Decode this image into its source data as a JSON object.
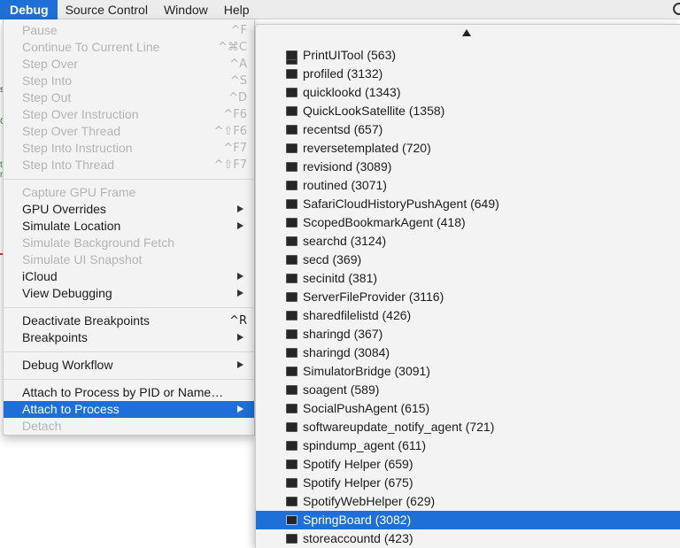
{
  "menubar": {
    "items": [
      "Debug",
      "Source Control",
      "Window",
      "Help"
    ]
  },
  "debug_menu": {
    "items": [
      {
        "label": "Pause",
        "shortcut": "^F",
        "enabled": false
      },
      {
        "label": "Continue To Current Line",
        "shortcut": "^⌘C",
        "enabled": false
      },
      {
        "label": "Step Over",
        "shortcut": "^A",
        "enabled": false
      },
      {
        "label": "Step Into",
        "shortcut": "^S",
        "enabled": false
      },
      {
        "label": "Step Out",
        "shortcut": "^D",
        "enabled": false
      },
      {
        "label": "Step Over Instruction",
        "shortcut": "^F6",
        "enabled": false
      },
      {
        "label": "Step Over Thread",
        "shortcut": "^⇧F6",
        "enabled": false
      },
      {
        "label": "Step Into Instruction",
        "shortcut": "^F7",
        "enabled": false
      },
      {
        "label": "Step Into Thread",
        "shortcut": "^⇧F7",
        "enabled": false
      },
      {
        "label": "Capture GPU Frame",
        "shortcut": "",
        "enabled": false
      },
      {
        "label": "GPU Overrides",
        "shortcut": "",
        "enabled": true,
        "submenu": true
      },
      {
        "label": "Simulate Location",
        "shortcut": "",
        "enabled": true,
        "submenu": true
      },
      {
        "label": "Simulate Background Fetch",
        "shortcut": "",
        "enabled": false
      },
      {
        "label": "Simulate UI Snapshot",
        "shortcut": "",
        "enabled": false
      },
      {
        "label": "iCloud",
        "shortcut": "",
        "enabled": true,
        "submenu": true
      },
      {
        "label": "View Debugging",
        "shortcut": "",
        "enabled": true,
        "submenu": true
      },
      {
        "label": "Deactivate Breakpoints",
        "shortcut": "^R",
        "enabled": true
      },
      {
        "label": "Breakpoints",
        "shortcut": "",
        "enabled": true,
        "submenu": true
      },
      {
        "label": "Debug Workflow",
        "shortcut": "",
        "enabled": true,
        "submenu": true
      },
      {
        "label": "Attach to Process by PID or Name…",
        "shortcut": "",
        "enabled": true
      },
      {
        "label": "Attach to Process",
        "shortcut": "",
        "enabled": true,
        "submenu": true,
        "highlighted": true
      },
      {
        "label": "Detach",
        "shortcut": "",
        "enabled": false
      }
    ]
  },
  "process_submenu": {
    "items": [
      "PrintUITool (563)",
      "profiled (3132)",
      "quicklookd (1343)",
      "QuickLookSatellite (1358)",
      "recentsd (657)",
      "reversetemplated (720)",
      "revisiond (3089)",
      "routined (3071)",
      "SafariCloudHistoryPushAgent (649)",
      "ScopedBookmarkAgent (418)",
      "searchd (3124)",
      "secd (369)",
      "secinitd (381)",
      "ServerFileProvider (3116)",
      "sharedfilelistd (426)",
      "sharingd (367)",
      "sharingd (3084)",
      "SimulatorBridge (3091)",
      "soagent (589)",
      "SocialPushAgent (615)",
      "softwareupdate_notify_agent (721)",
      "spindump_agent (611)",
      "Spotify Helper (659)",
      "Spotify Helper (675)",
      "SpotifyWebHelper (629)",
      "SpringBoard (3082)",
      "storeaccountd (423)"
    ],
    "highlighted": "SpringBoard (3082)"
  },
  "colors": {
    "accent": "#1e6fd8",
    "disabled_text": "#b4b4b4"
  },
  "icons": {
    "process": "terminal-icon",
    "submenu": "chevron-right-icon",
    "scroll": "scroll-up-arrow-icon",
    "search": "spotlight-search-icon"
  }
}
